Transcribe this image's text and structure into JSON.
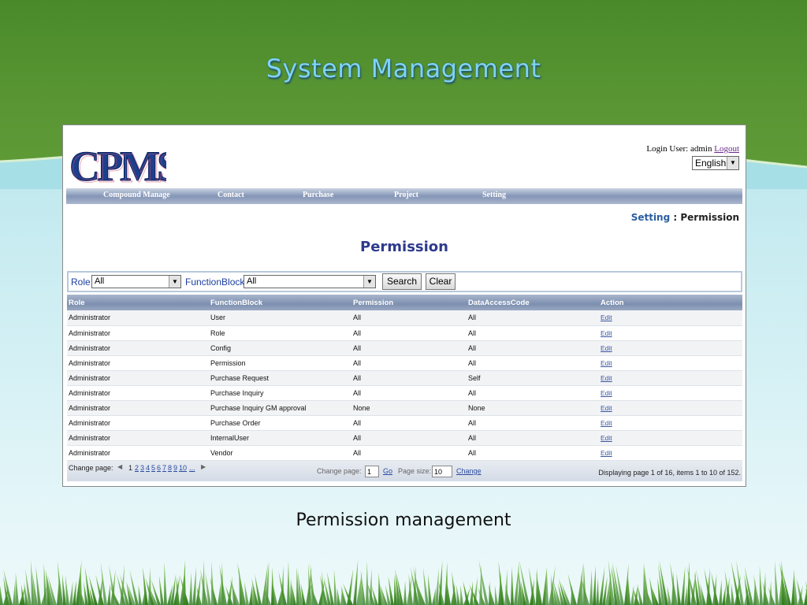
{
  "slide": {
    "title": "System Management",
    "caption": "Permission management"
  },
  "app": {
    "logo_text": "CPMS",
    "login_label": "Login User:",
    "login_user": "admin",
    "logout_label": "Logout",
    "language": "English",
    "nav": [
      "Compound Manage",
      "Contact",
      "Purchase",
      "Project",
      "Setting"
    ],
    "breadcrumb": {
      "parent": "Setting",
      "separator": " : ",
      "current": "Permission"
    },
    "page_heading": "Permission",
    "filter": {
      "role_label": "Role",
      "role_value": "All",
      "function_label": "FunctionBlock",
      "function_value": "All",
      "search_label": "Search",
      "clear_label": "Clear"
    },
    "table": {
      "columns": [
        "Role",
        "FunctionBlock",
        "Permission",
        "DataAccessCode",
        "Action"
      ],
      "rows": [
        [
          "Administrator",
          "User",
          "All",
          "All",
          "Edit"
        ],
        [
          "Administrator",
          "Role",
          "All",
          "All",
          "Edit"
        ],
        [
          "Administrator",
          "Config",
          "All",
          "All",
          "Edit"
        ],
        [
          "Administrator",
          "Permission",
          "All",
          "All",
          "Edit"
        ],
        [
          "Administrator",
          "Purchase Request",
          "All",
          "Self",
          "Edit"
        ],
        [
          "Administrator",
          "Purchase Inquiry",
          "All",
          "All",
          "Edit"
        ],
        [
          "Administrator",
          "Purchase Inquiry GM approval",
          "None",
          "None",
          "Edit"
        ],
        [
          "Administrator",
          "Purchase Order",
          "All",
          "All",
          "Edit"
        ],
        [
          "Administrator",
          "InternalUser",
          "All",
          "All",
          "Edit"
        ],
        [
          "Administrator",
          "Vendor",
          "All",
          "All",
          "Edit"
        ]
      ]
    },
    "pager": {
      "change_page_label": "Change page:",
      "current_page": "1",
      "pages": [
        "2",
        "3",
        "4",
        "5",
        "6",
        "7",
        "8",
        "9",
        "10",
        "..."
      ],
      "change_page_input_label": "Change page:",
      "change_page_input_value": "1",
      "go_label": "Go",
      "page_size_label": "Page size:",
      "page_size_value": "10",
      "change_label": "Change",
      "status": "Displaying page 1 of 16, items 1 to 10 of 152."
    }
  }
}
